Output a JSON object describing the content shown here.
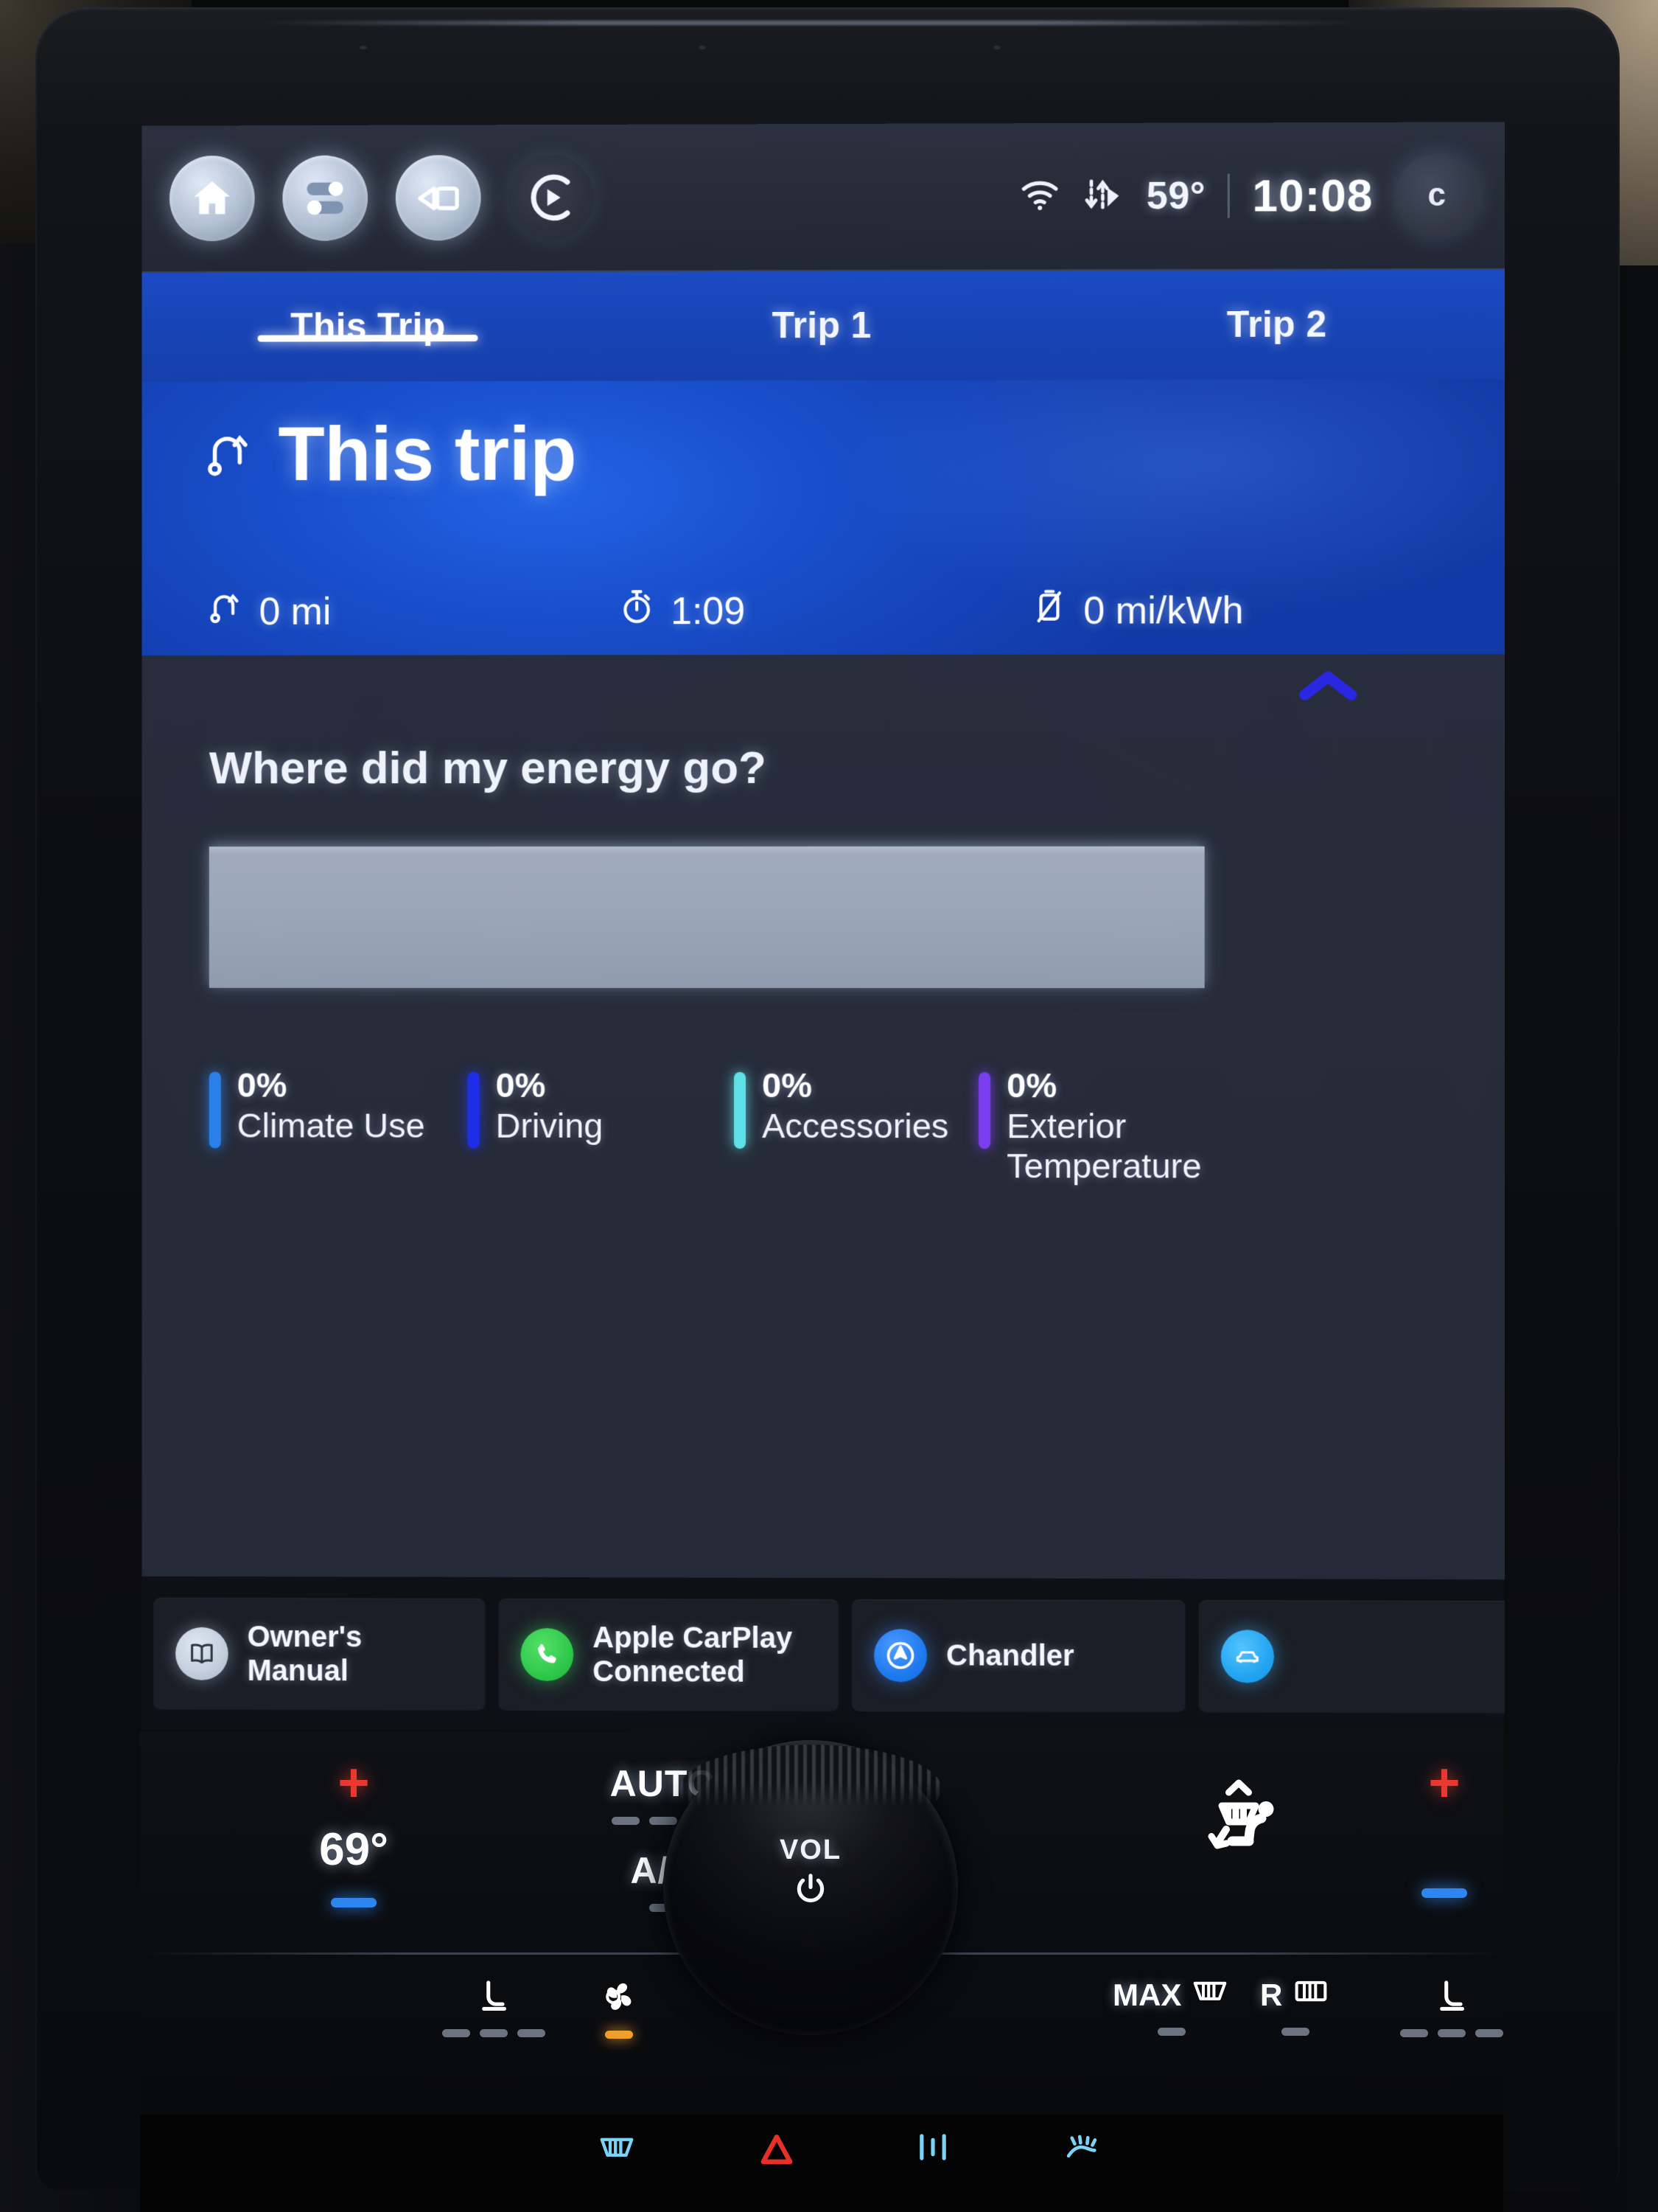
{
  "statusbar": {
    "icons": [
      {
        "name": "home-icon",
        "label": "Home"
      },
      {
        "name": "apps-icon",
        "label": "Features"
      },
      {
        "name": "camera-icon",
        "label": "Camera"
      },
      {
        "name": "media-play-icon",
        "label": "Media"
      }
    ],
    "wifi_icon": "wifi-icon",
    "data-transfer_icon": "data-transfer-icon",
    "temperature": "59°",
    "clock": "10:08",
    "profile_initial": "c"
  },
  "tabs": [
    {
      "label": "This Trip",
      "active": true
    },
    {
      "label": "Trip 1",
      "active": false
    },
    {
      "label": "Trip 2",
      "active": false
    }
  ],
  "hero": {
    "icon": "winding-road-icon",
    "title": "This trip",
    "stats": [
      {
        "icon": "winding-road-icon",
        "value": "0 mi"
      },
      {
        "icon": "stopwatch-icon",
        "value": "1:09"
      },
      {
        "icon": "efficiency-battery-icon",
        "value": "0 mi/kWh"
      }
    ]
  },
  "energy": {
    "heading": "Where did my energy go?",
    "collapse_icon": "chevron-up-icon",
    "legend": [
      {
        "percent": "0%",
        "label": "Climate Use",
        "color": "#2a7fe8"
      },
      {
        "percent": "0%",
        "label": "Driving",
        "color": "#1e2ee8"
      },
      {
        "percent": "0%",
        "label": "Accessories",
        "color": "#5fe0e8"
      },
      {
        "percent": "0%",
        "label": "Exterior Temperature",
        "color": "#7a3df0"
      }
    ]
  },
  "chart_data": {
    "type": "bar",
    "title": "Where did my energy go?",
    "categories": [
      "Climate Use",
      "Driving",
      "Accessories",
      "Exterior Temperature"
    ],
    "values": [
      0,
      0,
      0,
      0
    ],
    "unit": "%",
    "colors": [
      "#2a7fe8",
      "#1e2ee8",
      "#5fe0e8",
      "#7a3df0"
    ],
    "xlabel": "",
    "ylabel": "",
    "ylim": [
      0,
      100
    ],
    "legend_position": "below",
    "grid": false,
    "note": "Stacked horizontal bar is empty — all four contributors are 0%"
  },
  "tray": [
    {
      "icon": "book-icon",
      "label": "Owner's Manual",
      "label2": ""
    },
    {
      "icon": "phone-icon",
      "label": "Apple CarPlay",
      "label2": "Connected"
    },
    {
      "icon": "navigation-arrow-icon",
      "label": "Chandler",
      "label2": ""
    },
    {
      "icon": "car-icon",
      "label": "",
      "label2": ""
    }
  ],
  "climate": {
    "left": {
      "plus": "+",
      "temperature": "69°",
      "minus": "−",
      "seat_icon": "heated-seat-icon",
      "fan_icon": "fan-icon"
    },
    "center": {
      "auto_label": "AUTO",
      "ac_label": "A/C",
      "volume_label": "VOL",
      "power_icon": "power-icon"
    },
    "right": {
      "airflow_icon": "airflow-person-icon",
      "plus": "+",
      "minus": "−",
      "max_defrost_label": "MAX",
      "rear_defrost_label": "R",
      "seat_icon": "heated-seat-icon"
    }
  },
  "hard_buttons": [
    {
      "name": "front-defrost-icon",
      "color": "#7ad4f5"
    },
    {
      "name": "hazard-icon",
      "color": "#e8302a"
    },
    {
      "name": "park-assist-icon",
      "color": "#7ad4f5"
    },
    {
      "name": "traction-control-icon",
      "color": "#7ad4f5"
    }
  ]
}
